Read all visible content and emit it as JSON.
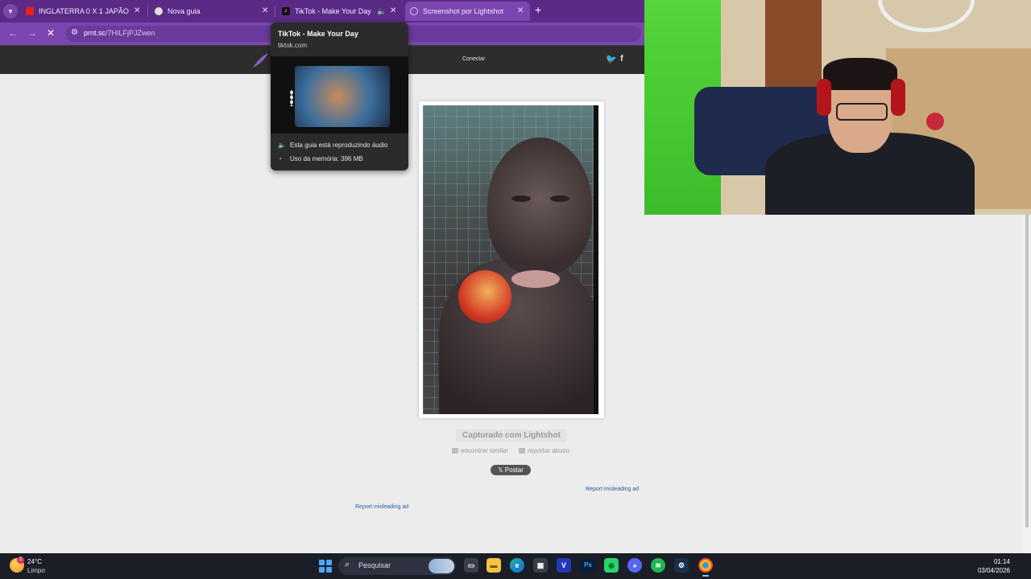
{
  "browser": {
    "tabs": [
      {
        "label": "INGLATERRA 0 X 1 JAPÃO | ME",
        "favicon": "youtube-icon",
        "active": false
      },
      {
        "label": "Nova guia",
        "favicon": "chrome-icon",
        "active": false
      },
      {
        "label": "TikTok - Make Your Day",
        "favicon": "tiktok-icon",
        "active": false,
        "audio": true
      },
      {
        "label": "Screenshot por Lightshot",
        "favicon": "lightshot-icon",
        "active": true
      }
    ],
    "url_host": "prnt.sc",
    "url_path": "/7HILFjPJZwen"
  },
  "tooltip": {
    "title": "TikTok - Make Your Day",
    "host": "tiktok.com",
    "audio_text": "Esta guia está reproduzindo áudio",
    "memory_text": "Uso da memória: 396 MB"
  },
  "site": {
    "connect_label": "Conectar",
    "twitter_glyph": "🐦",
    "facebook_glyph": "f",
    "caption": "Capturado com Lightshot",
    "find_similar": "encontrar similar",
    "report_abuse": "reportar abuso",
    "post_button": "𝕏 Postar",
    "ad_report_1": "Report misleading ad",
    "ad_report_2": "Report misleading ad"
  },
  "taskbar": {
    "weather_temp": "24°C",
    "weather_desc": "Limpo",
    "weather_badge": "2",
    "search_placeholder": "Pesquisar",
    "time": "01:14",
    "date": "03/04/2026",
    "apps": [
      "file-explorer-icon",
      "explorer-icon",
      "edge-icon",
      "store-icon",
      "vegas-icon",
      "photoshop-icon",
      "app-green-icon",
      "discord-icon",
      "spotify-icon",
      "steam-icon",
      "chrome-icon"
    ]
  },
  "colors": {
    "tabbar": "#5b2a86",
    "accent": "#7b46b0",
    "link": "#2a5d9f"
  }
}
